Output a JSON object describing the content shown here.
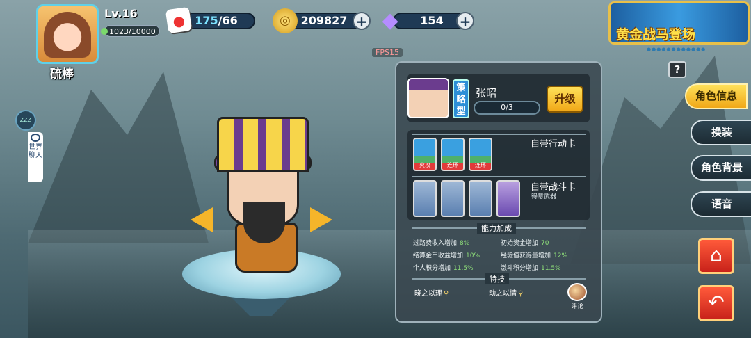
{
  "player": {
    "name": "硫棒",
    "level": "Lv.16",
    "xp": "1023/10000"
  },
  "resources": {
    "stamina_current": "175",
    "stamina_max": "/66",
    "gold": "209827",
    "gems": "154"
  },
  "banner": {
    "text": "黄金战马登场",
    "dots": "●●●●●●●●●●●●"
  },
  "fps": "FPS15",
  "help": "?",
  "left": {
    "sleep": "ZZZ",
    "chat": "世界聊天"
  },
  "hero": {
    "name": "张昭",
    "type": "策略型",
    "progress": "0/3",
    "upgrade": "升级",
    "portrait_badge": "吴"
  },
  "action_cards": {
    "label": "自带行动卡",
    "cards": [
      "火攻",
      "连环",
      "连环"
    ]
  },
  "battle_cards": {
    "label": "自带战斗卡",
    "weapon_note": "得意武器",
    "cards": [
      "",
      "",
      "",
      ""
    ]
  },
  "abilities": {
    "title": "能力加成",
    "stats": [
      {
        "label": "过路费收入增加",
        "value": "8%"
      },
      {
        "label": "初始资金增加",
        "value": "70"
      },
      {
        "label": "结算金币收益增加",
        "value": "10%"
      },
      {
        "label": "经验值获得量增加",
        "value": "12%"
      },
      {
        "label": "个人积分增加",
        "value": "11.5%"
      },
      {
        "label": "激斗积分增加",
        "value": "11.5%"
      }
    ]
  },
  "skills": {
    "title": "特技",
    "items": [
      "晓之以理",
      "动之以情"
    ],
    "comment": "评论"
  },
  "side_menu": {
    "items": [
      "角色信息",
      "换装",
      "角色背景",
      "语音"
    ],
    "active": "角色信息"
  },
  "colors": {
    "accent": "#f0a818",
    "panel": "#3a4850",
    "gem": "#b58cff"
  }
}
